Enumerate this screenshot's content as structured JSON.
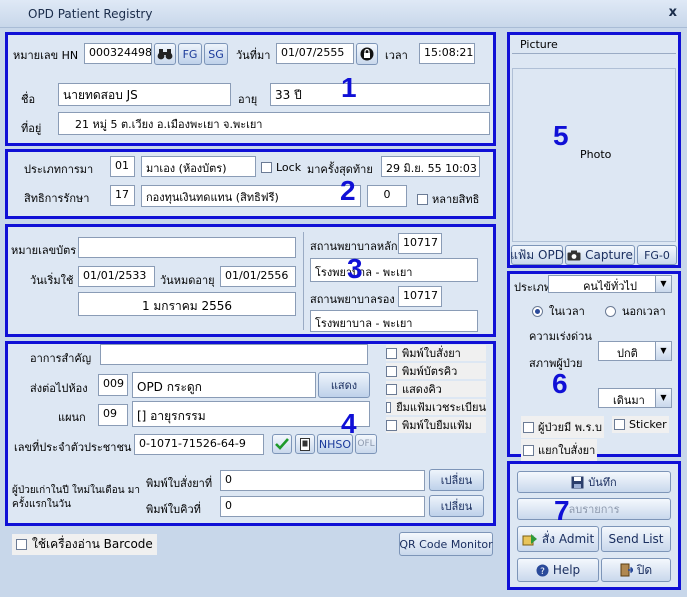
{
  "window": {
    "title": "OPD Patient Registry",
    "close": "x"
  },
  "patient": {
    "hn_label": "หมายเลข HN",
    "hn": "000324498",
    "fg": "FG",
    "sg": "SG",
    "date_label": "วันที่มา",
    "date": "01/07/2555",
    "time_label": "เวลา",
    "time": "15:08:21",
    "name_label": "ชื่อ",
    "name": "นายทดสอบ  JS",
    "age_label": "อายุ",
    "age": "33 ปี",
    "address_label": "ที่อยู่",
    "address": "21 หมู่ 5 ต.เวียง  อ.เมืองพะเยา จ.พะเยา"
  },
  "visit": {
    "type_label": "ประเภทการมา",
    "type_code": "01",
    "type_name": "มาเอง (ห้องบัตร)",
    "lock_label": "Lock",
    "last_label": "มาครั้งสุดท้าย",
    "last_value": "29 มิ.ย. 55 10:03",
    "right_label": "สิทธิการรักษา",
    "right_code": "17",
    "right_name": "กองทุนเงินทดแทน (สิทธิฟรี)",
    "right_count": "0",
    "multi_label": "หลายสิทธิ"
  },
  "card": {
    "card_no_label": "หมายเลขบัตร",
    "card_no": "",
    "start_label": "วันเริ่มใช้",
    "start": "01/01/2533",
    "expire_label": "วันหมดอายุ",
    "expire": "01/01/2556",
    "expire_text": "1 มกราคม 2556",
    "main_hosp_label": "สถานพยาบาลหลัก",
    "main_hosp_code": "10717",
    "main_hosp_name": "โรงพยาบาล - พะเยา",
    "sub_hosp_label": "สถานพยาบาลรอง",
    "sub_hosp_code": "10717",
    "sub_hosp_name": "โรงพยาบาล - พะเยา"
  },
  "send": {
    "complaint_label": "อาการสำคัญ",
    "complaint": "",
    "room_label": "ส่งต่อไปห้อง",
    "room_code": "009",
    "room_name": "OPD กระดูก",
    "show_btn": "แสดง",
    "dept_label": "แผนก",
    "dept_code": "09",
    "dept_name": "[] อายุรกรรม",
    "cid_label": "เลขที่ประจำตัวประชาชน",
    "cid": "0-1071-71526-64-9",
    "nhso": "NHSO",
    "ofl": "OFL",
    "options": [
      "พิมพ์ใบสั่งยา",
      "พิมพ์บัตรคิว",
      "แสดงคิว",
      "ยืมแฟ้มเวชระเบียน",
      "พิมพ์ใบยืมแฟ้ม"
    ],
    "old_new_label": "ผู้ป่วยเก่าในปี ใหม่ในเดือน มาครั้งแรกในวัน",
    "print_rx_label": "พิมพ์ใบสั่งยาที่",
    "print_rx": "0",
    "print_q_label": "พิมพ์ใบคิวที่",
    "print_q": "0",
    "change1": "เปลี่ยน",
    "change2": "เปลี่ยน"
  },
  "barcode": {
    "label": "ใช้เครื่องอ่าน Barcode",
    "qr": "QR Code Monitor"
  },
  "picture": {
    "header": "Picture",
    "photo": "Photo",
    "opd": "แฟ้ม OPD",
    "capture": "Capture",
    "fg0": "FG-0"
  },
  "options6": {
    "type_label": "ประเภท",
    "type_value": "คนไข้ทั่วไป",
    "in_time": "ในเวลา",
    "out_time": "นอกเวลา",
    "urgency_label": "ความเร่งด่วน",
    "urgency": "ปกติ",
    "status_label": "สภาพผู้ป่วย",
    "status": "เดินมา",
    "insured": "ผู้ป่วยมี พ.ร.บ",
    "sticker": "Sticker",
    "split_rx": "แยกใบสั่งยา"
  },
  "actions": {
    "save": "บันทึก",
    "delete": "ลบรายการ",
    "admit": "สั่ง Admit",
    "send_list": "Send List",
    "help": "Help",
    "close": "ปิด"
  },
  "markers": [
    "1",
    "2",
    "3",
    "4",
    "5",
    "6",
    "7"
  ]
}
